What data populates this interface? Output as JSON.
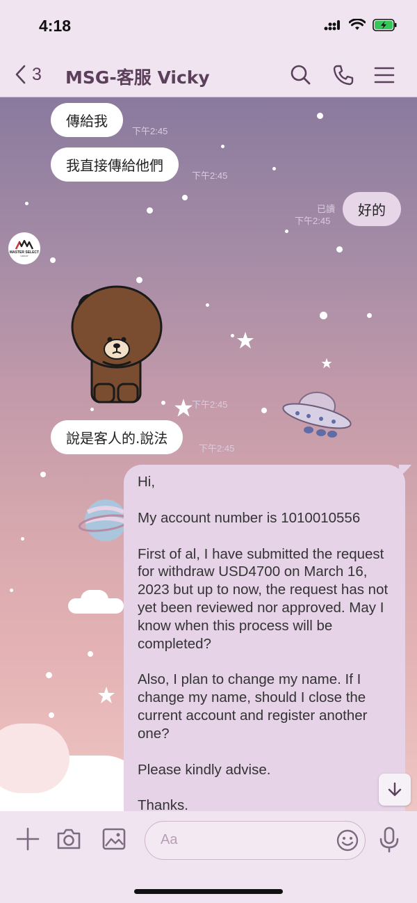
{
  "status_bar": {
    "time": "4:18"
  },
  "header": {
    "back_count": "3",
    "title": "MSG-客服 Vicky"
  },
  "avatar": {
    "name": "MASTER SELECT",
    "subtitle": "GROUP"
  },
  "messages": {
    "m1": {
      "text": "傳給我",
      "time": "下午2:45"
    },
    "m2": {
      "text": "我直接傳給他們",
      "time": "下午2:45"
    },
    "m3": {
      "text": "好的",
      "read": "已讀",
      "time": "下午2:45"
    },
    "sticker": {
      "name": "brown-bear-sticker",
      "time": "下午2:45"
    },
    "m4": {
      "text": "說是客人的.說法",
      "time": "下午2:45"
    },
    "m5": {
      "paragraphs": [
        "Hi,",
        "My account number is 1010010556",
        "First of al, I have submitted the request for withdraw USD4700 on March 16, 2023 but up to now, the request has not yet been reviewed nor approved.  May I know when this process will be completed?",
        "Also, I plan to change my name.  If I change my name, should I close the current account and register another one?",
        "Please kindly advise.",
        "Thanks."
      ]
    }
  },
  "input": {
    "placeholder": "Aa"
  },
  "colors": {
    "header_text": "#5b3f5b",
    "bubble_out": "#e6d6e8",
    "bubble_in": "#ffffff"
  }
}
